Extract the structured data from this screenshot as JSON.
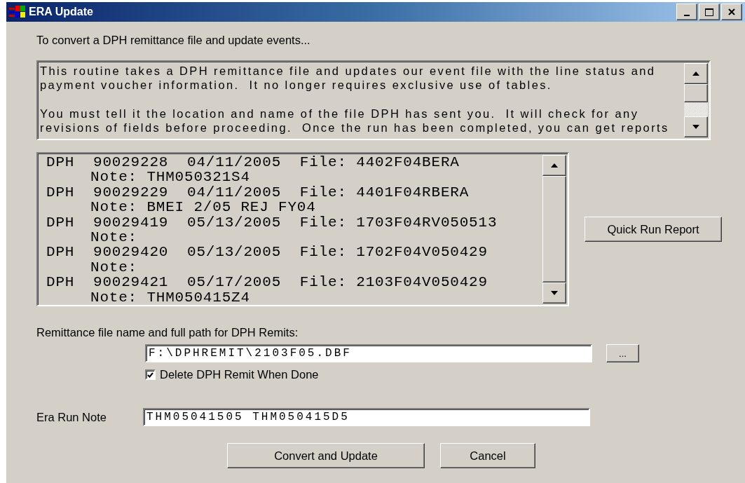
{
  "window": {
    "title": "ERA Update"
  },
  "heading": "To convert a DPH remittance file and update events...",
  "description": [
    [
      "This routine takes a DPH remittance file and updates our event file with the line status and",
      "payment voucher information.  It no longer requires exclusive use of tables."
    ],
    [
      "You must tell it the location and name of the file DPH has sent you.  It will check for any",
      "revisions of fields before proceeding.  Once the run has been completed, you can get reports"
    ]
  ],
  "runs": [
    {
      "line": "DPH  90029228  04/11/2005  File: 4402F04BERA",
      "note": "Note: THM050321S4"
    },
    {
      "line": "DPH  90029229  04/11/2005  File: 4401F04RBERA",
      "note": "Note: BMEI 2/05 REJ FY04"
    },
    {
      "line": "DPH  90029419  05/13/2005  File: 1703F04RV050513",
      "note": "Note:"
    },
    {
      "line": "DPH  90029420  05/13/2005  File: 1702F04V050429",
      "note": "Note:"
    },
    {
      "line": "DPH  90029421  05/17/2005  File: 2103F04V050429",
      "note": "Note: THM050415Z4"
    }
  ],
  "quick_run_button": "Quick Run Report",
  "remit_label": "Remittance file name and full path for DPH Remits:",
  "remit_field": {
    "value": "F:\\DPHREMIT\\2103F05.DBF"
  },
  "browse_button": "...",
  "delete_checkbox": {
    "label": "Delete DPH Remit When Done",
    "checked": true
  },
  "note_label": "Era Run Note",
  "note_field": {
    "value": "THM05041505 THM050415D5"
  },
  "buttons": [
    "Convert and Update",
    "Cancel"
  ]
}
